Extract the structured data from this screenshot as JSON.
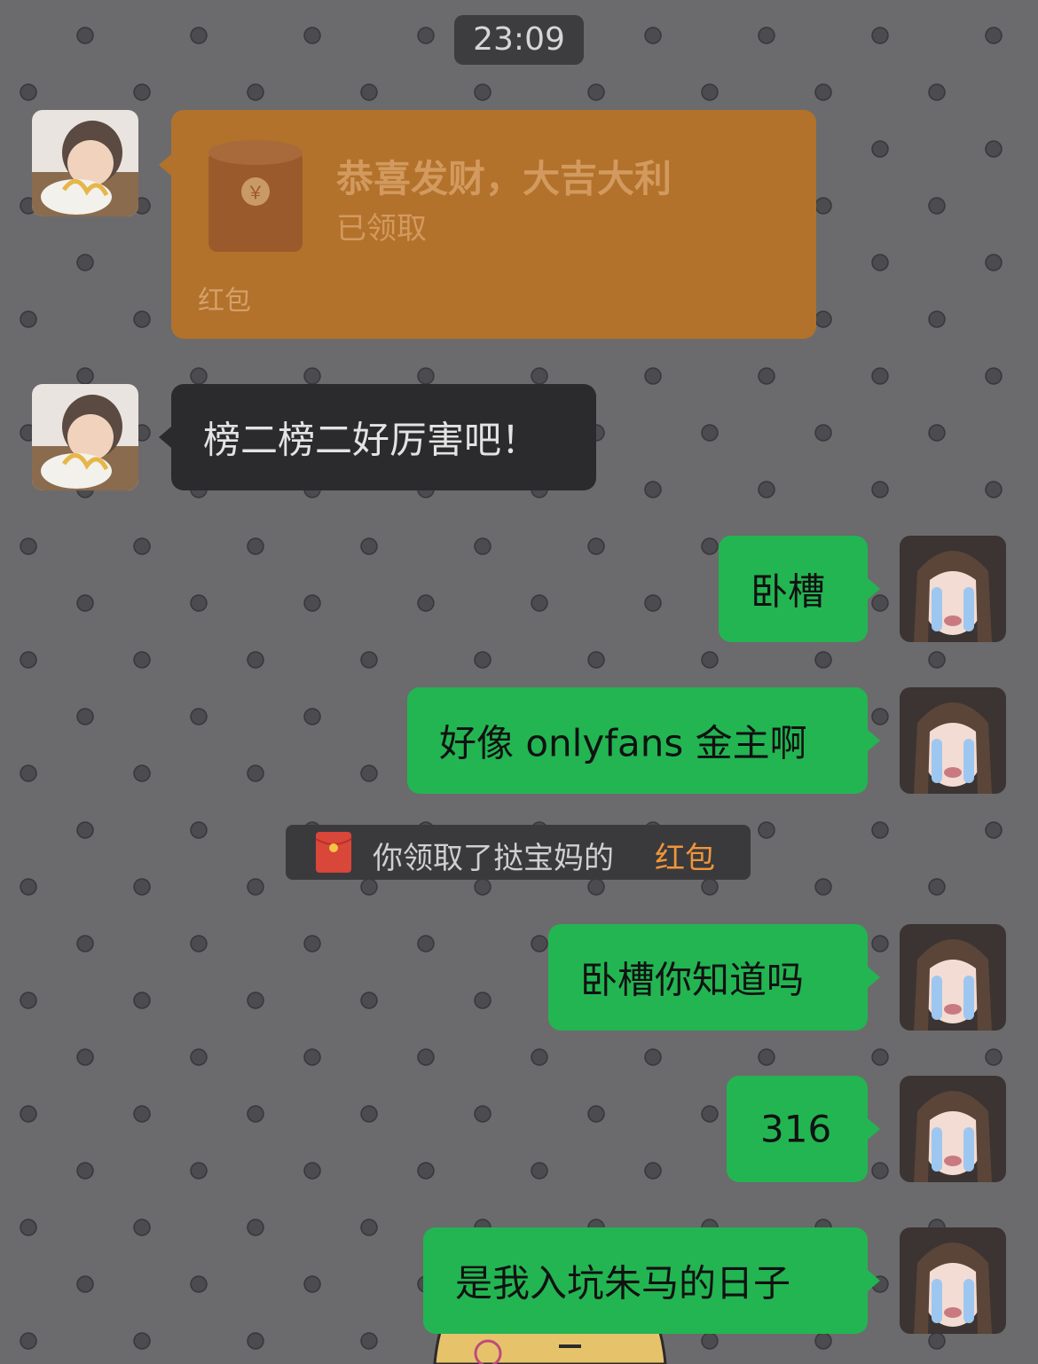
{
  "timestamp": "23:09",
  "messages": {
    "red_packet": {
      "title": "恭喜发财，大吉大利",
      "status": "已领取",
      "label": "红包",
      "colors": {
        "bubble": "#b2722b",
        "text": "#d39a5f"
      }
    },
    "m1": "榜二榜二好厉害吧！",
    "m2": "卧槽",
    "m3": "好像 onlyfans 金主啊",
    "system": {
      "prefix": "你领取了挞宝妈的",
      "link": "红包",
      "icon": "red-packet-icon"
    },
    "m4": "卧槽你知道吗",
    "m5": "316",
    "m6": "是我入坑朱马的日子"
  },
  "colors": {
    "background": "#6b6b6d",
    "dark_bubble": "#2b2b2d",
    "green_bubble": "#23b552",
    "link": "#f0953a"
  }
}
